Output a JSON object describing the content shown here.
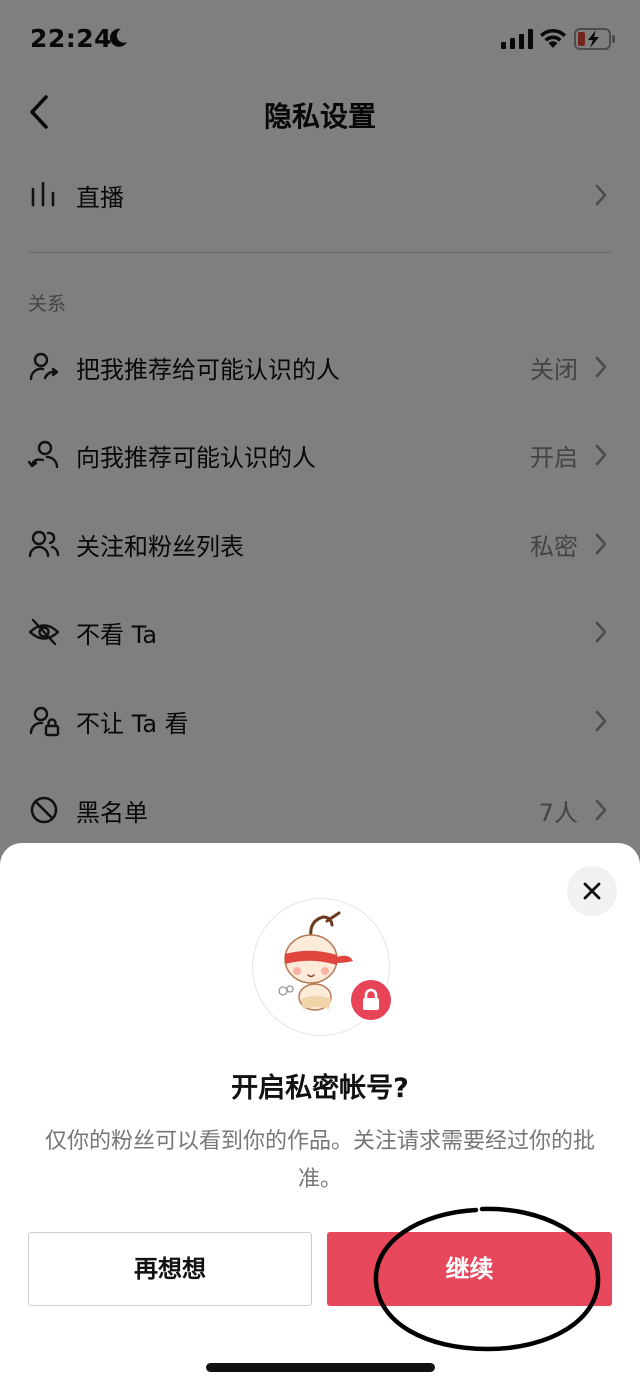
{
  "status_bar": {
    "time": "22:24"
  },
  "nav": {
    "title": "隐私设置"
  },
  "live_row": {
    "label": "直播"
  },
  "relations": {
    "section_title": "关系",
    "items": [
      {
        "label": "把我推荐给可能认识的人",
        "value": "关闭"
      },
      {
        "label": "向我推荐可能认识的人",
        "value": "开启"
      },
      {
        "label": "关注和粉丝列表",
        "value": "私密"
      },
      {
        "label": "不看 Ta",
        "value": ""
      },
      {
        "label": "不让 Ta 看",
        "value": ""
      },
      {
        "label": "黑名单",
        "value": "7人"
      }
    ]
  },
  "dialog": {
    "title": "开启私密帐号?",
    "description": "仅你的粉丝可以看到你的作品。关注请求需要经过你的批准。",
    "cancel_label": "再想想",
    "continue_label": "继续"
  },
  "colors": {
    "accent": "#e8485c",
    "overlay": "rgba(0,0,0,0.5)"
  }
}
